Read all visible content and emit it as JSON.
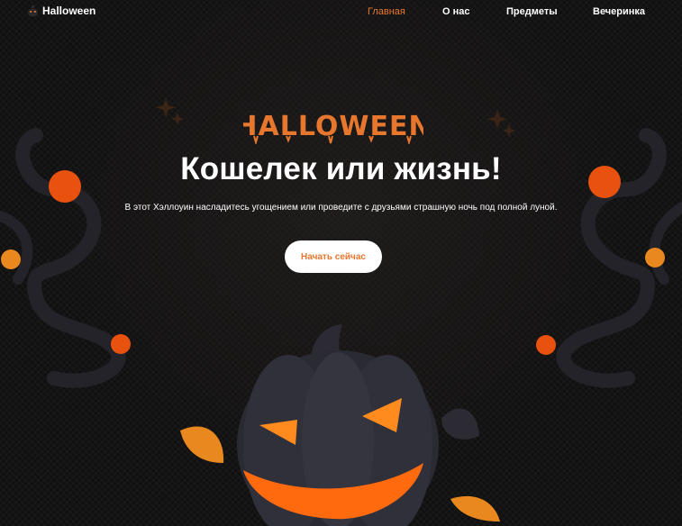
{
  "header": {
    "logo_text": "Halloween",
    "logo_icon": "pumpkin-icon",
    "nav": [
      {
        "label": "Главная",
        "active": true
      },
      {
        "label": "О нас",
        "active": false
      },
      {
        "label": "Предметы",
        "active": false
      },
      {
        "label": "Вечеринка",
        "active": false
      }
    ]
  },
  "hero": {
    "title_graphic_text": "HALLOWEEN",
    "headline": "Кошелек или жизнь!",
    "subtitle": "В этот Хэллоуин насладитесь угощением или проведите с друзьями страшную ночь под полной луной.",
    "cta_label": "Начать сейчас"
  },
  "colors": {
    "accent": "#e8772e",
    "background": "#111010",
    "text": "#ffffff"
  }
}
